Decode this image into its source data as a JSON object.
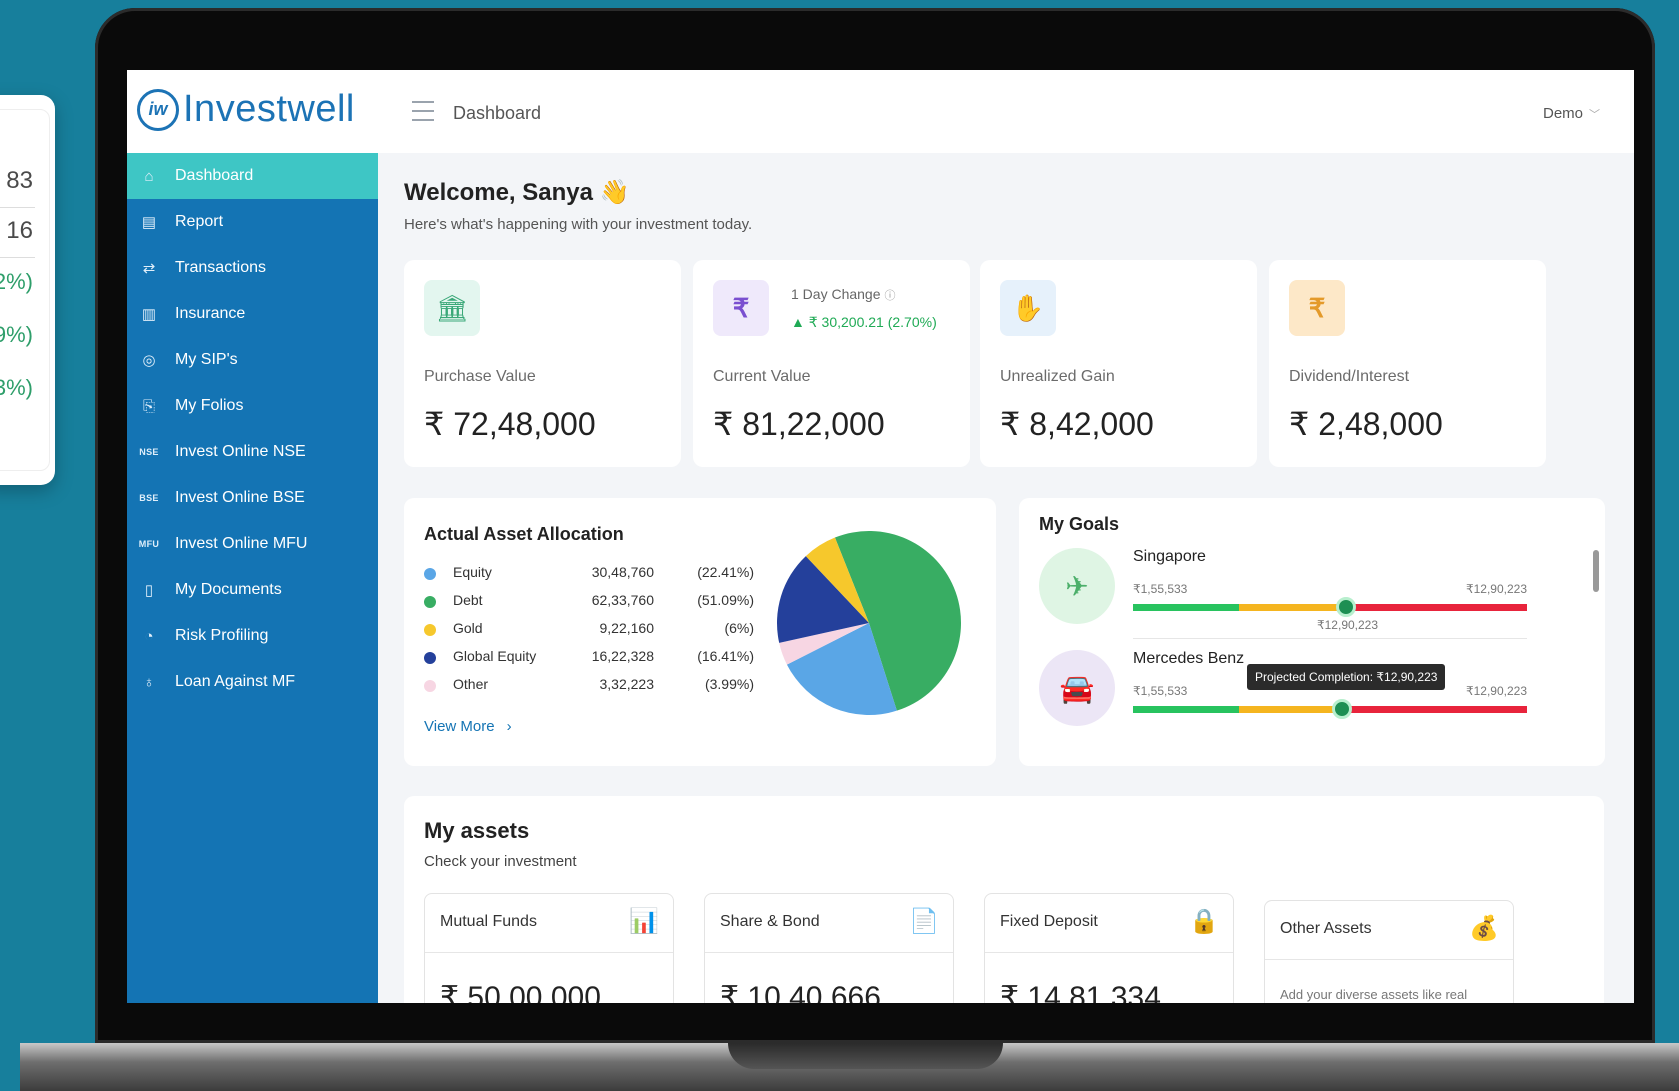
{
  "side_card": {
    "numbers": [
      "83",
      "16"
    ],
    "percents": [
      "2%)",
      "9%)",
      "3%)"
    ]
  },
  "brand": {
    "logo_mark": "iw",
    "name": "Investwell"
  },
  "header": {
    "title": "Dashboard",
    "user": "Demo"
  },
  "sidebar": {
    "items": [
      {
        "label": "Dashboard",
        "icon": "home-icon",
        "glyph": "⌂"
      },
      {
        "label": "Report",
        "icon": "report-icon",
        "glyph": "▤"
      },
      {
        "label": "Transactions",
        "icon": "transfer-icon",
        "glyph": "⇄"
      },
      {
        "label": "Insurance",
        "icon": "insurance-icon",
        "glyph": "▥"
      },
      {
        "label": "My SIP's",
        "icon": "sip-icon",
        "glyph": "◎"
      },
      {
        "label": "My Folios",
        "icon": "folio-icon",
        "glyph": "⎘"
      },
      {
        "label": "Invest Online NSE",
        "icon": "nse-icon",
        "glyph": "NSE"
      },
      {
        "label": "Invest Online BSE",
        "icon": "bse-icon",
        "glyph": "BSE"
      },
      {
        "label": "Invest Online MFU",
        "icon": "mfu-icon",
        "glyph": "MFU"
      },
      {
        "label": "My Documents",
        "icon": "document-icon",
        "glyph": "▯"
      },
      {
        "label": "Risk Profiling",
        "icon": "gauge-icon",
        "glyph": "◔"
      },
      {
        "label": "Loan Against MF",
        "icon": "loan-icon",
        "glyph": "♁"
      }
    ],
    "active_index": 0
  },
  "welcome": {
    "title": "Welcome, Sanya 👋",
    "subtitle": "Here's what's happening with your investment today."
  },
  "stats": [
    {
      "label": "Purchase Value",
      "value": "₹ 72,48,000",
      "icon": "bank-icon",
      "glyph": "🏛",
      "icon_bg": "#e3f6ef"
    },
    {
      "label": "Current Value",
      "value": "₹ 81,22,000",
      "icon": "coins-icon",
      "glyph": "₹",
      "icon_bg": "#efe9fb",
      "change_label": "1 Day Change",
      "change_value": "▲ ₹ 30,200.21 (2.70%)"
    },
    {
      "label": "Unrealized Gain",
      "value": "₹ 8,42,000",
      "icon": "gain-icon",
      "glyph": "✋",
      "icon_bg": "#e6f1fb"
    },
    {
      "label": "Dividend/Interest",
      "value": "₹ 2,48,000",
      "icon": "money-bag-icon",
      "glyph": "₹",
      "icon_bg": "#fde8c8"
    }
  ],
  "allocation": {
    "title": "Actual Asset Allocation",
    "view_more": "View More",
    "rows": [
      {
        "name": "Equity",
        "value": "30,48,760",
        "pct": "(22.41%)",
        "color": "#5aa6e6"
      },
      {
        "name": "Debt",
        "value": "62,33,760",
        "pct": "(51.09%)",
        "color": "#38ad63"
      },
      {
        "name": "Gold",
        "value": "9,22,160",
        "pct": "(6%)",
        "color": "#f6c82c"
      },
      {
        "name": "Global Equity",
        "value": "16,22,328",
        "pct": "(16.41%)",
        "color": "#24409b"
      },
      {
        "name": "Other",
        "value": "3,32,223",
        "pct": "(3.99%)",
        "color": "#f7d6e3"
      }
    ]
  },
  "chart_data": {
    "type": "pie",
    "categories": [
      "Debt",
      "Equity",
      "Other",
      "Global Equity",
      "Gold"
    ],
    "values": [
      51.09,
      22.41,
      3.99,
      16.41,
      6
    ],
    "colors": [
      "#38ad63",
      "#5aa6e6",
      "#f7d6e3",
      "#24409b",
      "#f6c82c"
    ]
  },
  "goals": {
    "title": "My Goals",
    "items": [
      {
        "name": "Singapore",
        "start": "₹1,55,533",
        "end": "₹12,90,223",
        "marker_label": "₹12,90,223",
        "progress": 0.54,
        "icon": "plane-icon",
        "glyph": "✈",
        "icon_bg": "#dff5e4",
        "icon_color": "#4caf6a"
      },
      {
        "name": "Mercedes Benz",
        "start": "₹1,55,533",
        "end": "₹12,90,223",
        "tooltip": "Projected Completion: ₹12,90,223",
        "progress": 0.53,
        "icon": "car-icon",
        "glyph": "🚘",
        "icon_bg": "#ece6f6",
        "icon_color": "#8a63c4"
      }
    ]
  },
  "assets": {
    "title": "My assets",
    "subtitle": "Check your investment",
    "items": [
      {
        "name": "Mutual Funds",
        "value": "₹ 50,00,000",
        "icon": "growth-chart-icon",
        "glyph": "📊"
      },
      {
        "name": "Share & Bond",
        "value": "₹ 10,40,666",
        "icon": "certificate-icon",
        "glyph": "📄"
      },
      {
        "name": "Fixed Deposit",
        "value": "₹ 14,81,334",
        "icon": "safe-icon",
        "glyph": "🔒"
      },
      {
        "name": "Other Assets",
        "note": "Add your diverse assets like real",
        "icon": "assets-icon",
        "glyph": "💰"
      }
    ]
  }
}
